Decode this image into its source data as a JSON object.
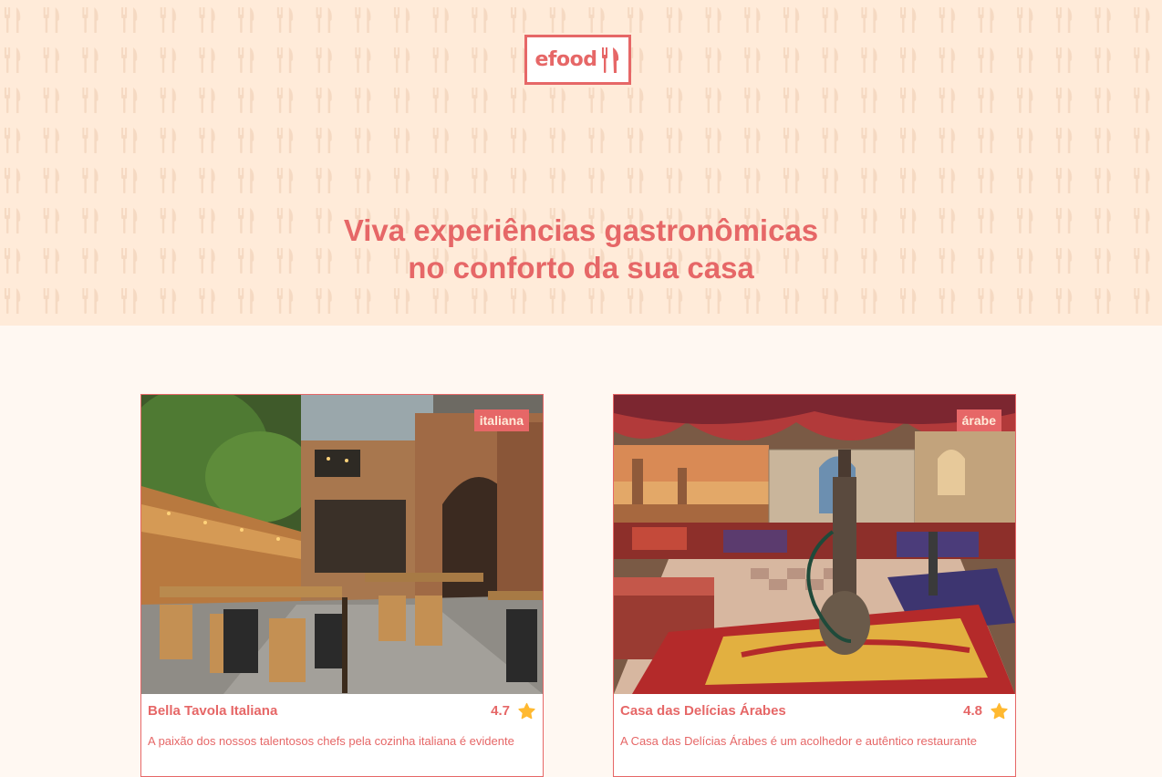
{
  "logo": {
    "text": "efood",
    "icon": "fork-knife-icon"
  },
  "hero": {
    "line1": "Viva experiências gastronômicas",
    "line2": "no conforto da sua casa"
  },
  "colors": {
    "accent": "#E66767",
    "hero_bg": "#FFEBD9",
    "page_bg": "#FFF8F2",
    "star": "#FFB930"
  },
  "restaurants": [
    {
      "name": "Bella Tavola Italiana",
      "tag": "italiana",
      "rating": "4.7",
      "description": "A paixão dos nossos talentosos chefs pela cozinha italiana é evidente",
      "image": "restaurant-interior-italian"
    },
    {
      "name": "Casa das Delícias Árabes",
      "tag": "árabe",
      "rating": "4.8",
      "description": "A Casa das Delícias Árabes é um acolhedor e autêntico restaurante",
      "image": "restaurant-interior-arabic"
    }
  ]
}
